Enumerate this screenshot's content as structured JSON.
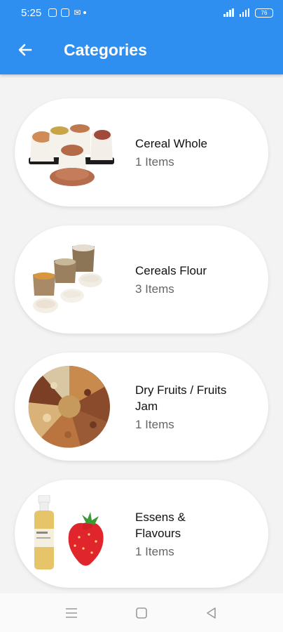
{
  "status_bar": {
    "time": "5:25",
    "battery": "76"
  },
  "app_bar": {
    "title": "Categories"
  },
  "categories": [
    {
      "name": "Cereal Whole",
      "count": "1 Items",
      "image": "cereal-sacks-image"
    },
    {
      "name": "Cereals Flour",
      "count": "3 Items",
      "image": "flour-sacks-image"
    },
    {
      "name": "Dry Fruits / Fruits Jam",
      "count": "1 Items",
      "image": "dry-fruits-image"
    },
    {
      "name": "Essens & Flavours",
      "count": "1 Items",
      "image": "essence-strawberry-image"
    }
  ],
  "nav": {
    "icons": [
      "menu-icon",
      "home-square-icon",
      "back-triangle-icon"
    ]
  },
  "colors": {
    "primary": "#2f8ff0",
    "background": "#f3f3f3",
    "card": "#ffffff"
  }
}
